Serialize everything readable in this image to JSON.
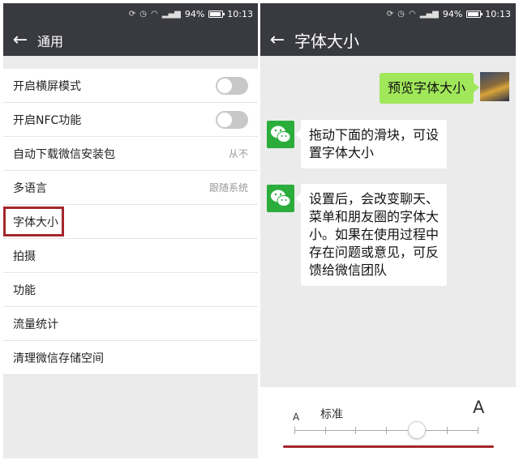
{
  "status_bar": {
    "battery": "94%",
    "time": "10:13"
  },
  "left_screen": {
    "title": "通用",
    "rows": [
      {
        "label": "开启横屏模式",
        "toggle": "off"
      },
      {
        "label": "开启NFC功能",
        "toggle": "off"
      },
      {
        "label": "自动下载微信安装包",
        "value": "从不"
      },
      {
        "label": "多语言",
        "value": "跟随系统"
      },
      {
        "label": "字体大小",
        "highlighted": true
      },
      {
        "label": "拍摄"
      },
      {
        "label": "功能"
      },
      {
        "label": "流量统计"
      },
      {
        "label": "清理微信存储空间"
      }
    ]
  },
  "right_screen": {
    "title": "字体大小",
    "messages": {
      "preview": "预览字体大小",
      "msg1_line1": "拖动下面的滑块，可设",
      "msg1_line2": "置字体大小",
      "msg2_line1": "设置后，会改变聊天、",
      "msg2_line2": "菜单和朋友圈的字体大",
      "msg2_line3": "小。如果在使用过程中",
      "msg2_line4": "存在问题或意见，可反",
      "msg2_line5": "馈给微信团队"
    },
    "slider": {
      "small_label": "A",
      "current_label": "标准",
      "large_label": "A",
      "level": 4,
      "levels": 7
    },
    "colors": {
      "sent_bubble": "#a0e75a",
      "wechat_green": "#2bad3c",
      "highlight": "#a4262c"
    }
  }
}
